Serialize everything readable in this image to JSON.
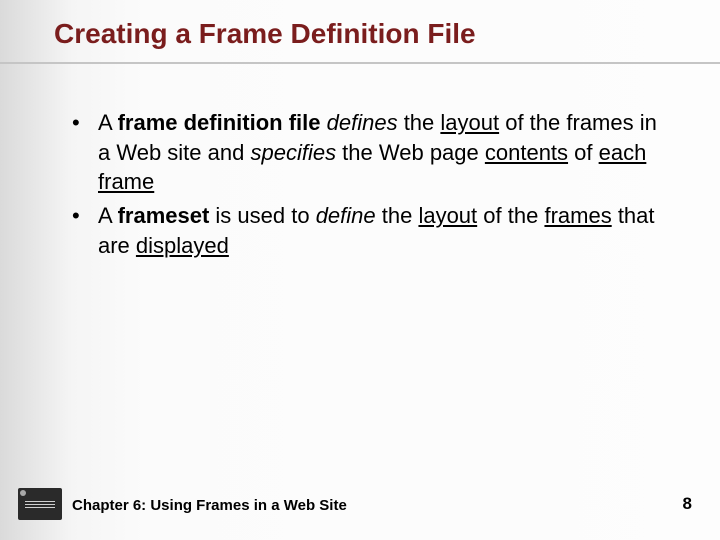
{
  "title": "Creating a Frame Definition File",
  "bullets": [
    {
      "segments": [
        {
          "t": "A ",
          "b": false,
          "i": false,
          "u": false
        },
        {
          "t": "frame definition file",
          "b": true,
          "i": false,
          "u": false
        },
        {
          "t": " ",
          "b": false,
          "i": false,
          "u": false
        },
        {
          "t": "defines",
          "b": false,
          "i": true,
          "u": false
        },
        {
          "t": " the ",
          "b": false,
          "i": false,
          "u": false
        },
        {
          "t": "layout",
          "b": false,
          "i": false,
          "u": true
        },
        {
          "t": " of the frames in a Web site and ",
          "b": false,
          "i": false,
          "u": false
        },
        {
          "t": "specifies",
          "b": false,
          "i": true,
          "u": false
        },
        {
          "t": " the Web page ",
          "b": false,
          "i": false,
          "u": false
        },
        {
          "t": "contents",
          "b": false,
          "i": false,
          "u": true
        },
        {
          "t": " of ",
          "b": false,
          "i": false,
          "u": false
        },
        {
          "t": "each",
          "b": false,
          "i": false,
          "u": true
        },
        {
          "t": " ",
          "b": false,
          "i": false,
          "u": false
        },
        {
          "t": "frame",
          "b": false,
          "i": false,
          "u": true
        }
      ]
    },
    {
      "segments": [
        {
          "t": "A ",
          "b": false,
          "i": false,
          "u": false
        },
        {
          "t": "frameset",
          "b": true,
          "i": false,
          "u": false
        },
        {
          "t": " is used to ",
          "b": false,
          "i": false,
          "u": false
        },
        {
          "t": "define",
          "b": false,
          "i": true,
          "u": false
        },
        {
          "t": " the ",
          "b": false,
          "i": false,
          "u": false
        },
        {
          "t": "layout",
          "b": false,
          "i": false,
          "u": true
        },
        {
          "t": " of the ",
          "b": false,
          "i": false,
          "u": false
        },
        {
          "t": "frames",
          "b": false,
          "i": false,
          "u": true
        },
        {
          "t": " that are ",
          "b": false,
          "i": false,
          "u": false
        },
        {
          "t": "displayed",
          "b": false,
          "i": false,
          "u": true
        }
      ]
    }
  ],
  "footer": {
    "chapter": "Chapter 6: Using Frames in a Web Site",
    "page": "8"
  }
}
